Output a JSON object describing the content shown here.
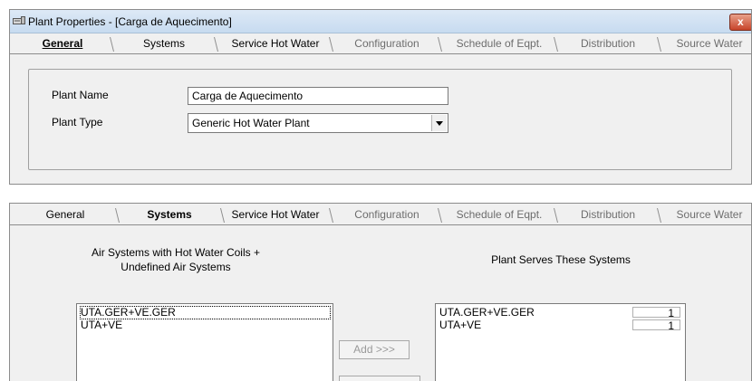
{
  "window": {
    "title": "Plant Properties - [Carga de Aquecimento]",
    "close_glyph": "x"
  },
  "tabs": [
    {
      "label": "General",
      "disabled": false
    },
    {
      "label": "Systems",
      "disabled": false
    },
    {
      "label": "Service Hot Water",
      "disabled": false
    },
    {
      "label": "Configuration",
      "disabled": true
    },
    {
      "label": "Schedule of Eqpt.",
      "disabled": true
    },
    {
      "label": "Distribution",
      "disabled": true
    },
    {
      "label": "Source Water",
      "disabled": true
    }
  ],
  "general": {
    "plant_name_label": "Plant Name",
    "plant_name_value": "Carga de Aquecimento",
    "plant_type_label": "Plant Type",
    "plant_type_value": "Generic Hot Water Plant"
  },
  "systems": {
    "available_heading": "Air Systems with Hot Water Coils + Undefined Air Systems",
    "available_items": [
      "UTA.GER+VE.GER",
      "UTA+VE"
    ],
    "served_heading": "Plant Serves These Systems",
    "served_items": [
      {
        "name": "UTA.GER+VE.GER",
        "count": "1"
      },
      {
        "name": "UTA+VE",
        "count": "1"
      }
    ],
    "add_button_label": "Add >>>"
  },
  "colors": {
    "dialog_bg": "#f0f0f0",
    "titlebar": "#c7dbf0",
    "close_button": "#c7442a",
    "disabled_text": "#6d6d6d"
  }
}
